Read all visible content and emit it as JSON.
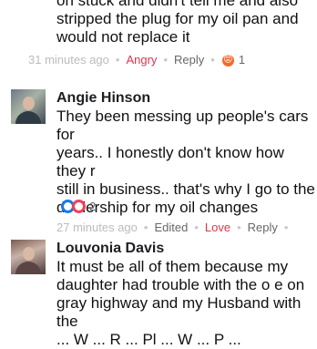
{
  "comments": [
    {
      "text": "on stuck and didn't tell me and also\nstripped the plug for my oil pan and\nwould not replace it",
      "timestamp": "31 minutes ago",
      "actions": [
        "Angry",
        "Reply"
      ],
      "reactions": {
        "icon": "angry-reaction-icon",
        "count": "1"
      }
    },
    {
      "author": "Angie Hinson",
      "text": "They been messing up people's cars for\nyears.. I honestly don't know how they r\nstill in business.. that's why I go to the\ndealership for my oil changes",
      "timestamp": "27 minutes ago",
      "actions": [
        "Edited",
        "Love",
        "Reply"
      ],
      "reactions": {
        "icons": [
          "like-reaction-icon",
          "love-reaction-icon"
        ],
        "count": "2"
      }
    },
    {
      "author": "Louvonia Davis",
      "text": "It must be all of them because my\ndaughter had trouble with the o e on\ngray highway and my Husband with the\n... W ... R ... Pl ... W ... P ..."
    }
  ],
  "colors": {
    "love": "#e0334d",
    "like": "#1877f2",
    "meta": "#a8adb3"
  }
}
